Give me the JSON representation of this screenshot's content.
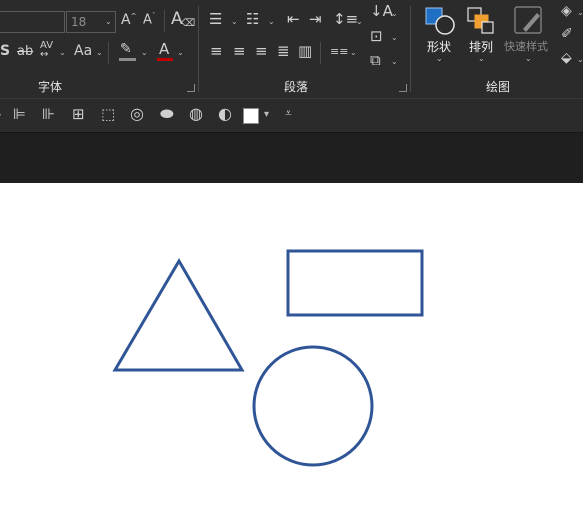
{
  "ribbon": {
    "font_group": {
      "label": "字体",
      "font_size": "18",
      "aa_label": "Aa",
      "av_label": "AV",
      "strike_label": "ab",
      "s_label": "S"
    },
    "paragraph_group": {
      "label": "段落"
    },
    "drawing_group": {
      "label": "绘图",
      "shapes_label": "形状",
      "arrange_label": "排列",
      "quick_styles_label": "快速样式"
    }
  },
  "colors": {
    "ribbon_bg": "#2b2b2b",
    "text_light": "#e6e6e6",
    "shape_stroke": "#2f5597",
    "highlight_orange": "#f0a030",
    "shape_blue": "#1f6fc5"
  },
  "slide": {
    "shapes": [
      {
        "type": "triangle",
        "name": "triangle"
      },
      {
        "type": "rectangle",
        "name": "rectangle"
      },
      {
        "type": "circle",
        "name": "circle"
      }
    ]
  }
}
